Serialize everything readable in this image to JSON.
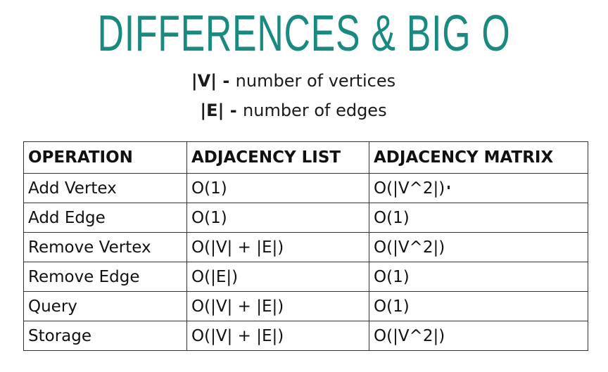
{
  "title": "DIFFERENCES & BIG O",
  "legend": [
    {
      "symbol": "|V|",
      "separator": " - ",
      "text": "number of vertices"
    },
    {
      "symbol": "|E|",
      "separator": " - ",
      "text": "number of edges"
    }
  ],
  "table": {
    "headers": [
      "OPERATION",
      "ADJACENCY LIST",
      "ADJACENCY MATRIX"
    ],
    "rows": [
      [
        "Add Vertex",
        "O(1)",
        "O(|V^2|)"
      ],
      [
        "Add Edge",
        "O(1)",
        "O(1)"
      ],
      [
        "Remove Vertex",
        "O(|V| + |E|)",
        "O(|V^2|)"
      ],
      [
        "Remove Edge",
        "O(|E|)",
        "O(1)"
      ],
      [
        "Query",
        "O(|V| + |E|)",
        "O(1)"
      ],
      [
        "Storage",
        "O(|V| + |E|)",
        "O(|V^2|)"
      ]
    ]
  }
}
